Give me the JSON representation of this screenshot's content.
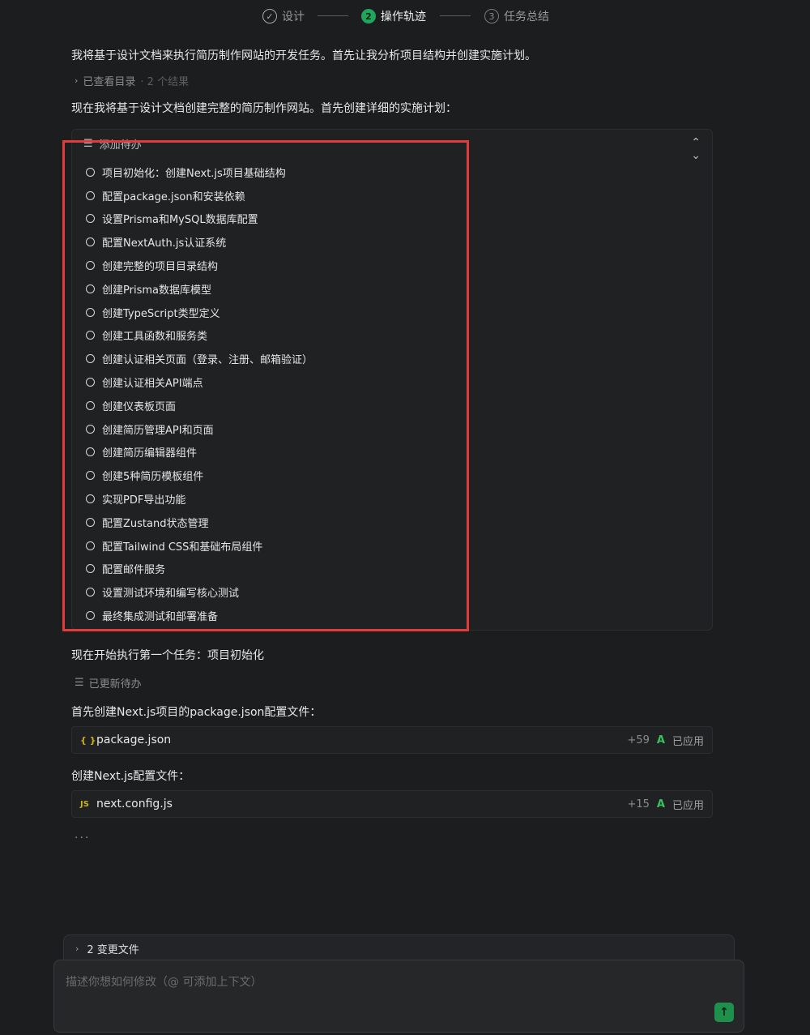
{
  "stepper": {
    "steps": [
      {
        "icon": "check-circle-icon",
        "glyph": "✓",
        "label": "设计"
      },
      {
        "icon": "step-number-icon",
        "glyph": "2",
        "label": "操作轨迹"
      },
      {
        "icon": "step-number-icon",
        "glyph": "3",
        "label": "任务总结"
      }
    ]
  },
  "chat": {
    "intro": "我将基于设计文档来执行简历制作网站的开发任务。首先让我分析项目结构并创建实施计划。",
    "viewed_dir": {
      "label": "已查看目录",
      "count": "· 2 个结果"
    },
    "plan_intro": "现在我将基于设计文档创建完整的简历制作网站。首先创建详细的实施计划：",
    "todo_card": {
      "title": "添加待办",
      "items": [
        "项目初始化：创建Next.js项目基础结构",
        "配置package.json和安装依赖",
        "设置Prisma和MySQL数据库配置",
        "配置NextAuth.js认证系统",
        "创建完整的项目目录结构",
        "创建Prisma数据库模型",
        "创建TypeScript类型定义",
        "创建工具函数和服务类",
        "创建认证相关页面（登录、注册、邮箱验证）",
        "创建认证相关API端点",
        "创建仪表板页面",
        "创建简历管理API和页面",
        "创建简历编辑器组件",
        "创建5种简历模板组件",
        "实现PDF导出功能",
        "配置Zustand状态管理",
        "配置Tailwind CSS和基础布局组件",
        "配置邮件服务",
        "设置测试环境和编写核心测试",
        "最终集成测试和部署准备"
      ]
    },
    "start_task": "现在开始执行第一个任务：项目初始化",
    "updated_todo": "已更新待办",
    "create_pkg_text": "首先创建Next.js项目的package.json配置文件：",
    "file1": {
      "icon_text": "{ }",
      "name": "package.json",
      "added": "+59",
      "badge": "A",
      "status": "已应用"
    },
    "create_cfg_text": "创建Next.js配置文件：",
    "file2": {
      "icon_text": "JS",
      "name": "next.config.js",
      "added": "+15",
      "badge": "A",
      "status": "已应用"
    },
    "loading": "···"
  },
  "changes": {
    "label": "2 变更文件"
  },
  "input": {
    "placeholder": "描述你想如何修改（@ 可添加上下文）"
  },
  "colors": {
    "accent_green": "#1fa65a",
    "highlight_red": "#e23b3b",
    "background": "#1c1d1f"
  }
}
